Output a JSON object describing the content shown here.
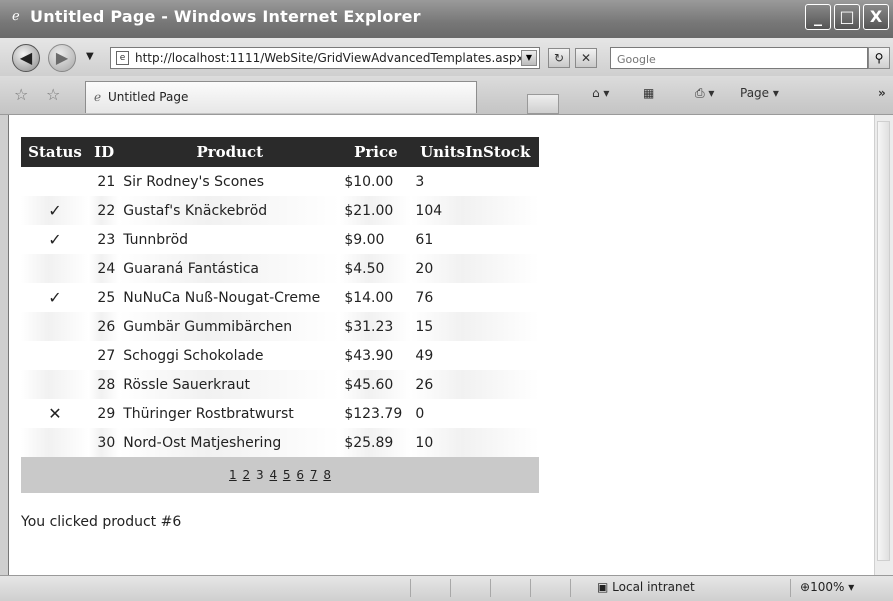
{
  "window": {
    "title": "Untitled Page - Windows Internet Explorer",
    "controls": [
      "_",
      "□",
      "X"
    ]
  },
  "address_bar": {
    "url": "http://localhost:1111/WebSite/GridViewAdvancedTemplates.aspx",
    "search_placeholder": "Google"
  },
  "tab": {
    "label": "Untitled Page"
  },
  "commands": {
    "page_label": "Page ▾"
  },
  "grid": {
    "headers": [
      "Status",
      "ID",
      "Product",
      "Price",
      "UnitsInStock"
    ],
    "rows": [
      {
        "status": "",
        "id": "21",
        "product": "Sir Rodney's Scones",
        "price": "$10.00",
        "units": "3"
      },
      {
        "status": "✓",
        "id": "22",
        "product": "Gustaf's Knäckebröd",
        "price": "$21.00",
        "units": "104"
      },
      {
        "status": "✓",
        "id": "23",
        "product": "Tunnbröd",
        "price": "$9.00",
        "units": "61"
      },
      {
        "status": "",
        "id": "24",
        "product": "Guaraná Fantástica",
        "price": "$4.50",
        "units": "20"
      },
      {
        "status": "✓",
        "id": "25",
        "product": "NuNuCa Nuß-Nougat-Creme",
        "price": "$14.00",
        "units": "76"
      },
      {
        "status": "",
        "id": "26",
        "product": "Gumbär Gummibärchen",
        "price": "$31.23",
        "units": "15"
      },
      {
        "status": "",
        "id": "27",
        "product": "Schoggi Schokolade",
        "price": "$43.90",
        "units": "49"
      },
      {
        "status": "",
        "id": "28",
        "product": "Rössle Sauerkraut",
        "price": "$45.60",
        "units": "26"
      },
      {
        "status": "✕",
        "id": "29",
        "product": "Thüringer Rostbratwurst",
        "price": "$123.79",
        "units": "0"
      },
      {
        "status": "",
        "id": "30",
        "product": "Nord-Ost Matjeshering",
        "price": "$25.89",
        "units": "10"
      }
    ],
    "pager": [
      "1",
      "2",
      "3",
      "4",
      "5",
      "6",
      "7",
      "8"
    ],
    "current_page": "3"
  },
  "message": "You clicked product #6",
  "status_bar": {
    "zone": "Local intranet",
    "zoom": "100%"
  }
}
